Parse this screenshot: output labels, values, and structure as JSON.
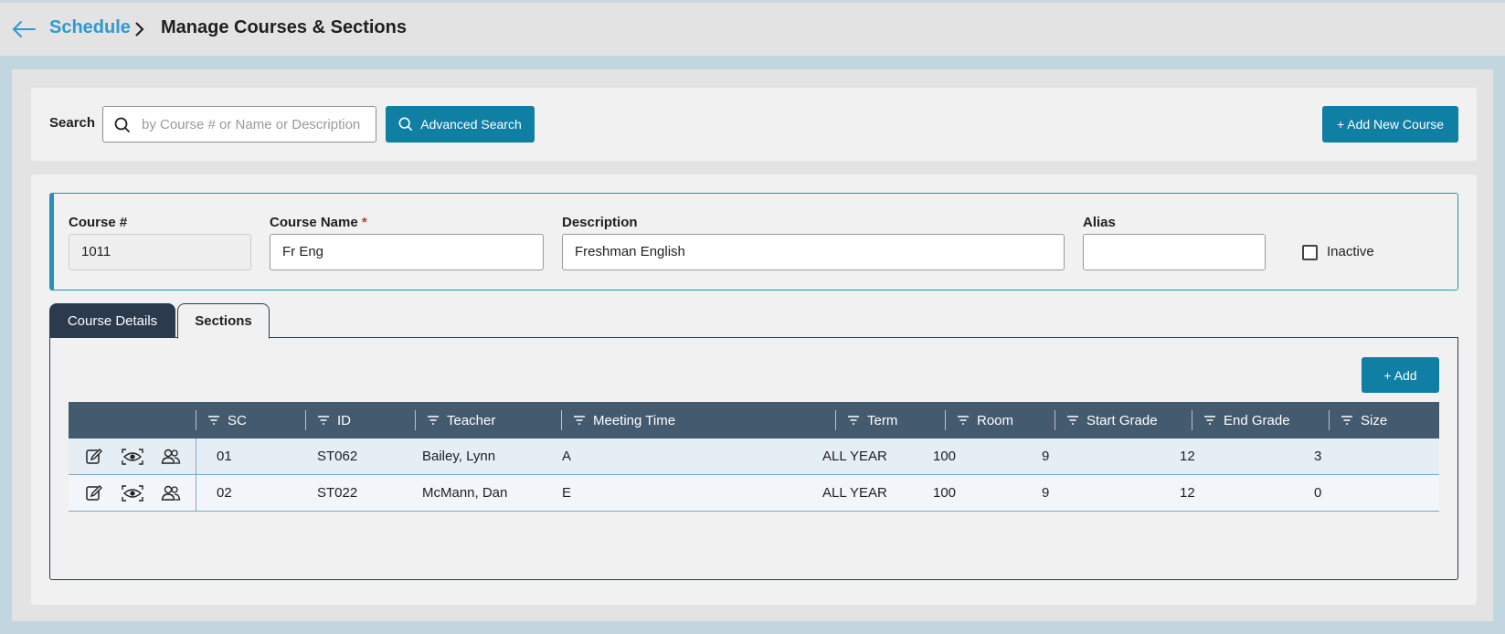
{
  "breadcrumb": {
    "parent": "Schedule",
    "current": "Manage Courses & Sections"
  },
  "search": {
    "label": "Search",
    "placeholder": "by Course # or Name or Description",
    "value": ""
  },
  "buttons": {
    "advanced_search": "Advanced Search",
    "add_new_course": "+ Add New Course",
    "add": "+ Add"
  },
  "course": {
    "number_label": "Course #",
    "number": "1011",
    "name_label": "Course Name",
    "required_marker": "*",
    "name": "Fr Eng",
    "description_label": "Description",
    "description": "Freshman English",
    "alias_label": "Alias",
    "alias": "",
    "inactive_label": "Inactive",
    "inactive": false
  },
  "tabs": [
    {
      "label": "Course Details",
      "active": false
    },
    {
      "label": "Sections",
      "active": true
    }
  ],
  "grid": {
    "columns": [
      "SC",
      "ID",
      "Teacher",
      "Meeting Time",
      "Term",
      "Room",
      "Start Grade",
      "End Grade",
      "Size"
    ],
    "rows": [
      {
        "sc": "01",
        "id": "ST062",
        "teacher": "Bailey, Lynn",
        "meeting_time": "A",
        "term": "ALL YEAR",
        "room": "100",
        "start_grade": "9",
        "end_grade": "12",
        "size": "3"
      },
      {
        "sc": "02",
        "id": "ST022",
        "teacher": "McMann, Dan",
        "meeting_time": "E",
        "term": "ALL YEAR",
        "room": "100",
        "start_grade": "9",
        "end_grade": "12",
        "size": "0"
      }
    ],
    "row_actions": [
      "edit-icon",
      "view-icon",
      "users-icon"
    ]
  },
  "colors": {
    "accent": "#0f7fa3",
    "link": "#2f9ad1",
    "header": "#445a6f",
    "dark_tab": "#2b3a4c"
  }
}
